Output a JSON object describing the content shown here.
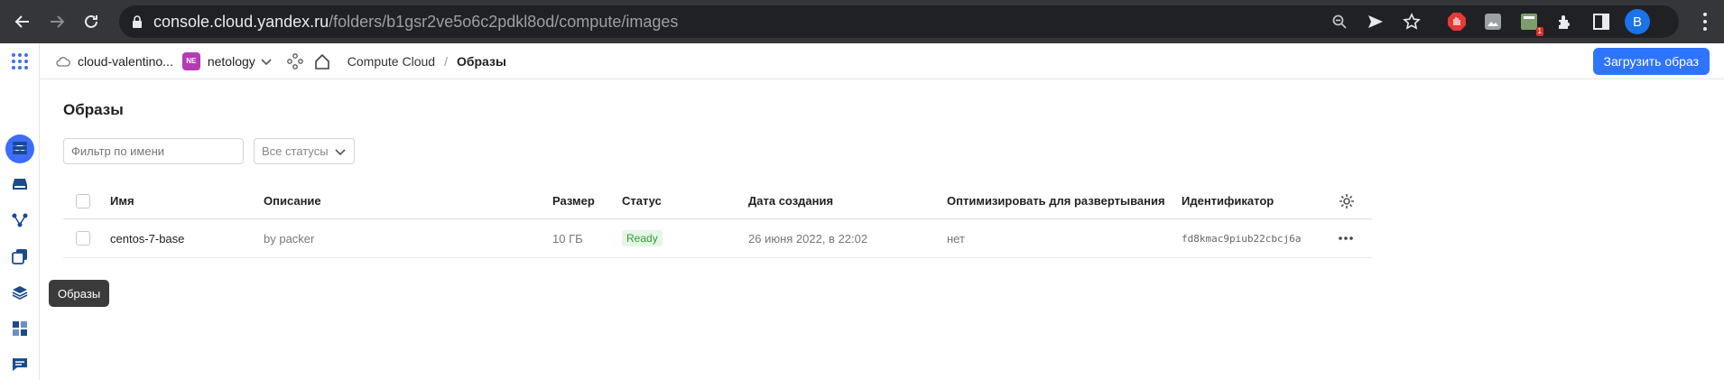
{
  "browser": {
    "url_host": "console.cloud.yandex.ru",
    "url_path": "/folders/b1gsr2ve5o6c2pdkl8od/compute/images",
    "profile_initial": "B",
    "extension_badge": "1"
  },
  "topbar": {
    "cloud_name": "cloud-valentino...",
    "folder_badge": "NE",
    "folder_name": "netology",
    "breadcrumb_service": "Compute Cloud",
    "breadcrumb_sep": "/",
    "breadcrumb_current": "Образы",
    "upload_button": "Загрузить образ"
  },
  "page": {
    "title": "Образы",
    "filter_placeholder": "Фильтр по имени",
    "status_filter": "Все статусы"
  },
  "table": {
    "headers": {
      "name": "Имя",
      "description": "Описание",
      "size": "Размер",
      "status": "Статус",
      "created": "Дата создания",
      "optimize": "Оптимизировать для развертывания",
      "id": "Идентификатор"
    },
    "rows": [
      {
        "name": "centos-7-base",
        "description": "by packer",
        "size": "10 ГБ",
        "status": "Ready",
        "created": "26 июня 2022, в 22:02",
        "optimize": "нет",
        "id": "fd8kmac9piub22cbcj6a"
      }
    ]
  },
  "tooltip": "Образы",
  "colors": {
    "accent": "#2d74ff",
    "status_ready_bg": "#e6f6e6",
    "status_ready_fg": "#2e9e3a"
  }
}
